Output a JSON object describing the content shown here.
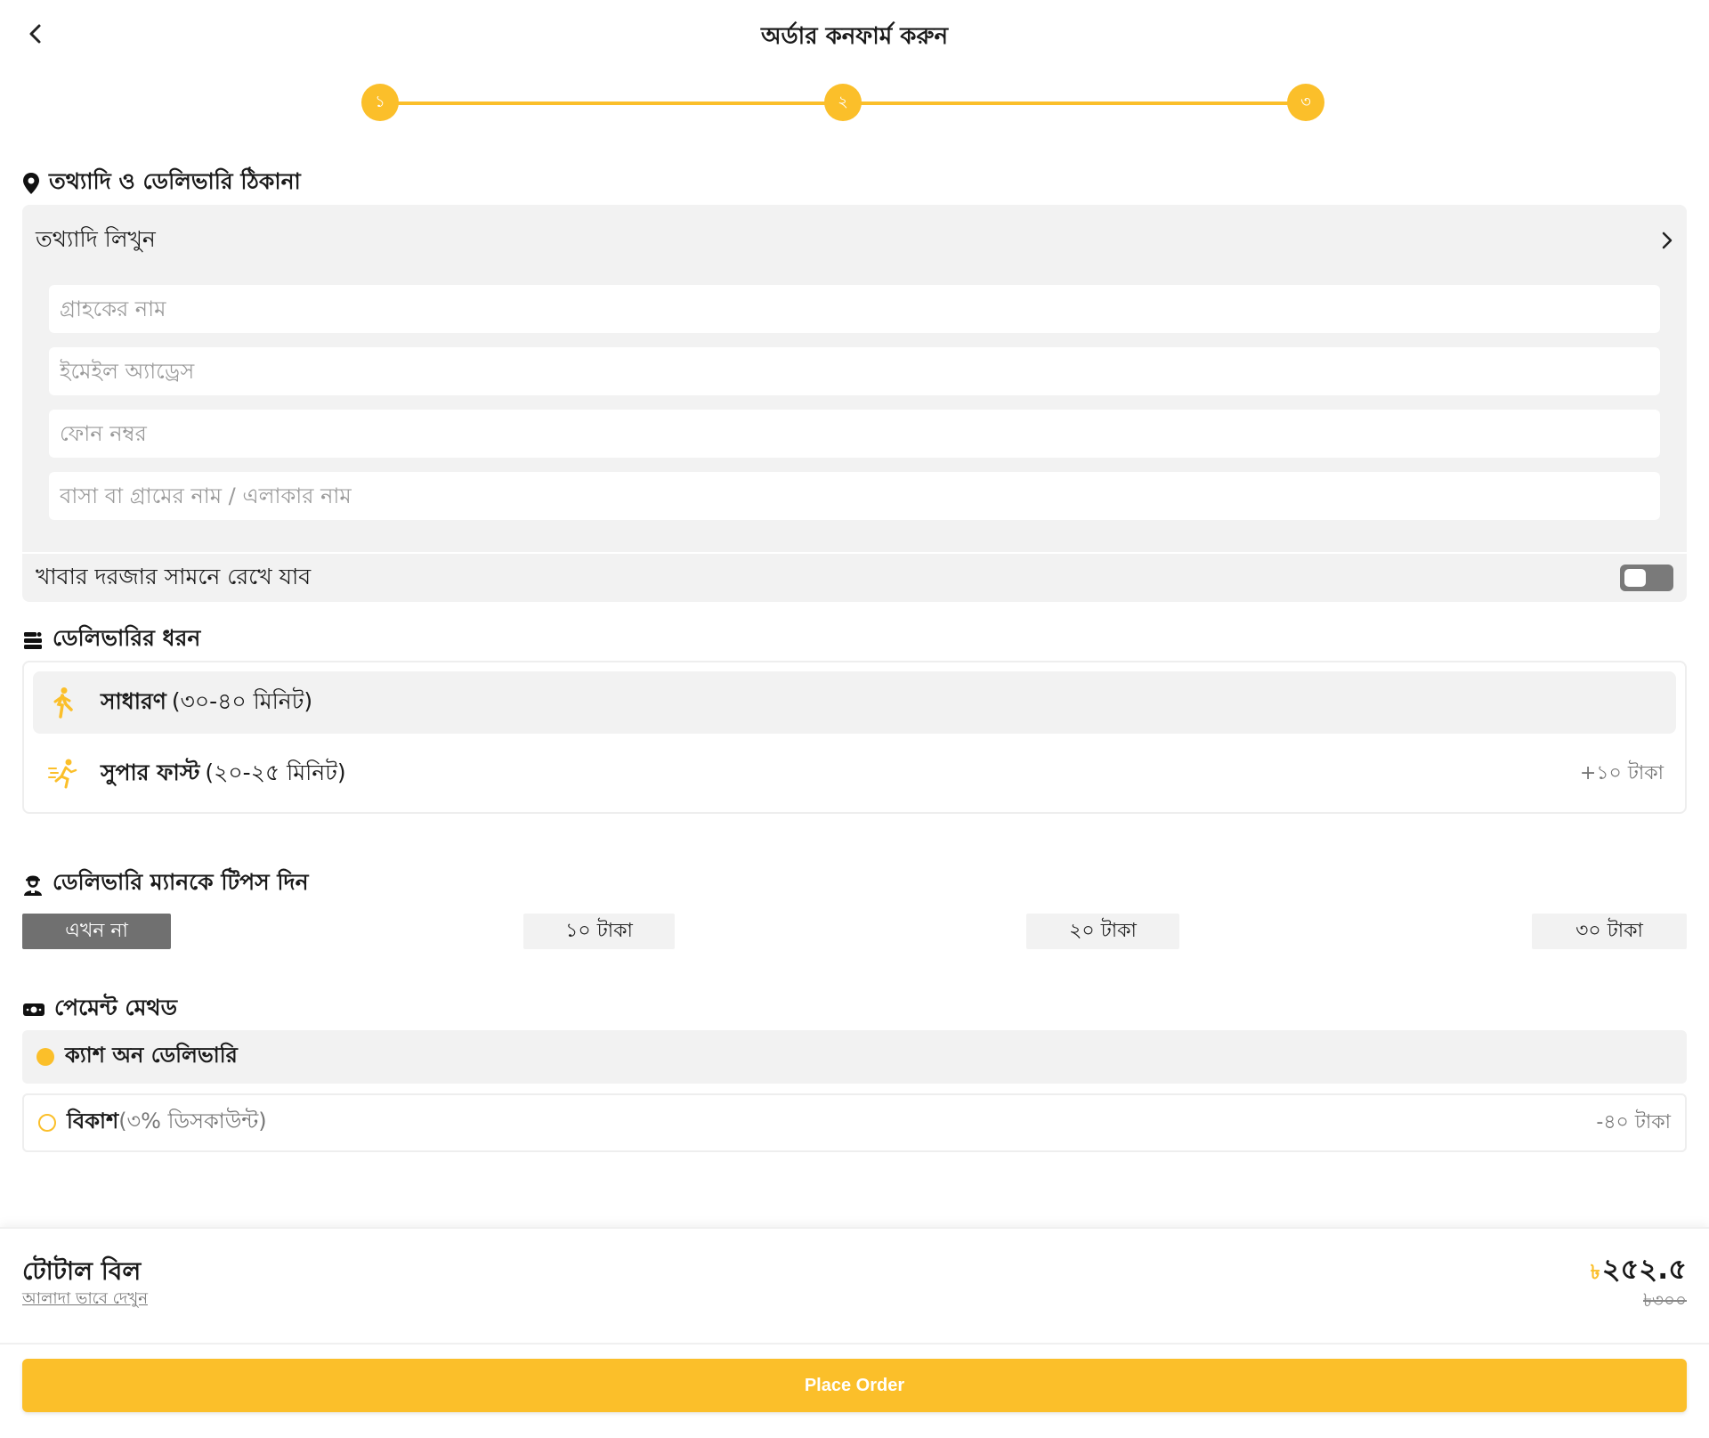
{
  "header": {
    "title": "অর্ডার কনফার্ম করুন"
  },
  "stepper": {
    "steps": [
      "১",
      "২",
      "৩"
    ]
  },
  "address_section": {
    "title": "তথ্যাদি ও ডেলিভারি ঠিকানা",
    "info_row_label": "তথ্যাদি লিখুন",
    "fields": {
      "name_placeholder": "গ্রাহকের নাম",
      "email_placeholder": "ইমেইল অ্যাড্রেস",
      "phone_placeholder": "ফোন নম্বর",
      "address_placeholder": "বাসা বা গ্রামের নাম / এলাকার নাম"
    },
    "leave_at_door_label": "খাবার দরজার সামনে রেখে যাব",
    "leave_at_door_on": false
  },
  "delivery_section": {
    "title": "ডেলিভারির ধরন",
    "options": [
      {
        "name": "সাধারণ",
        "detail": "(৩০-৪০ মিনিট)",
        "extra": "",
        "selected": true
      },
      {
        "name": "সুপার ফাস্ট",
        "detail": "(২০-২৫ মিনিট)",
        "extra": "+১০ টাকা",
        "selected": false
      }
    ]
  },
  "tips_section": {
    "title": "ডেলিভারি ম্যানকে টিপস দিন",
    "options": [
      "এখন না",
      "১০ টাকা",
      "২০ টাকা",
      "৩০ টাকা"
    ],
    "selected_index": 0
  },
  "payment_section": {
    "title": "পেমেন্ট মেথড",
    "methods": [
      {
        "name": "ক্যাশ অন ডেলিভারি",
        "note": "",
        "extra": "",
        "selected": true
      },
      {
        "name": "বিকাশ",
        "note": "(৩% ডিসকাউন্ট)",
        "extra": "-৪০ টাকা",
        "selected": false
      }
    ]
  },
  "footer": {
    "total_label": "টোটাল বিল",
    "view_separately": "আলাদা ভাবে দেখুন",
    "currency": "৳",
    "total": "২৫২.৫",
    "original_total": "৳৩০০",
    "place_order": "Place Order"
  },
  "colors": {
    "accent": "#fbbf2a",
    "panel": "#f2f2f2",
    "muted": "#707070"
  }
}
